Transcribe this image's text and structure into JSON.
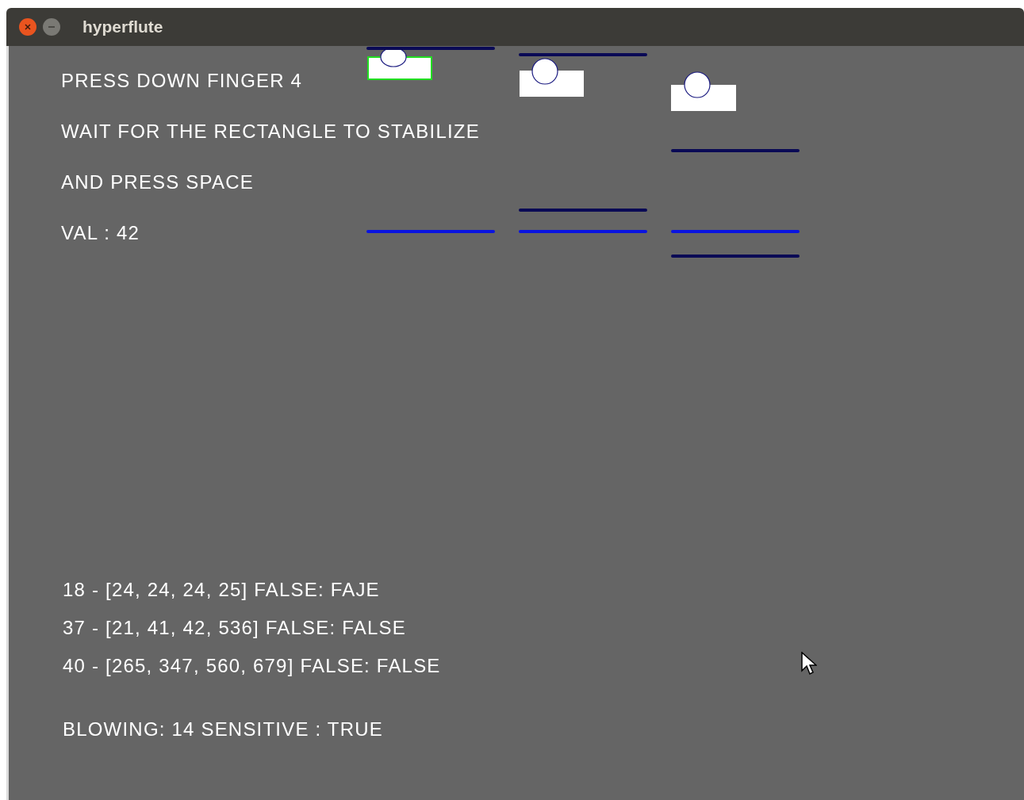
{
  "window": {
    "title": "hyperflute"
  },
  "instructions": [
    "PRESS DOWN FINGER 4",
    "WAIT FOR THE RECTANGLE TO STABILIZE",
    "AND PRESS SPACE"
  ],
  "value": "VAL : 42",
  "sensors": [
    {
      "selected": true
    },
    {
      "selected": false
    },
    {
      "selected": false
    }
  ],
  "readouts": [
    "18 - [24, 24, 24, 25] FALSE: FAJE",
    "37 - [21, 41, 42, 536] FALSE: FALSE",
    "40 - [265, 347, 560, 679] FALSE: FALSE"
  ],
  "status": "BLOWING: 14 SENSITIVE : TRUE"
}
